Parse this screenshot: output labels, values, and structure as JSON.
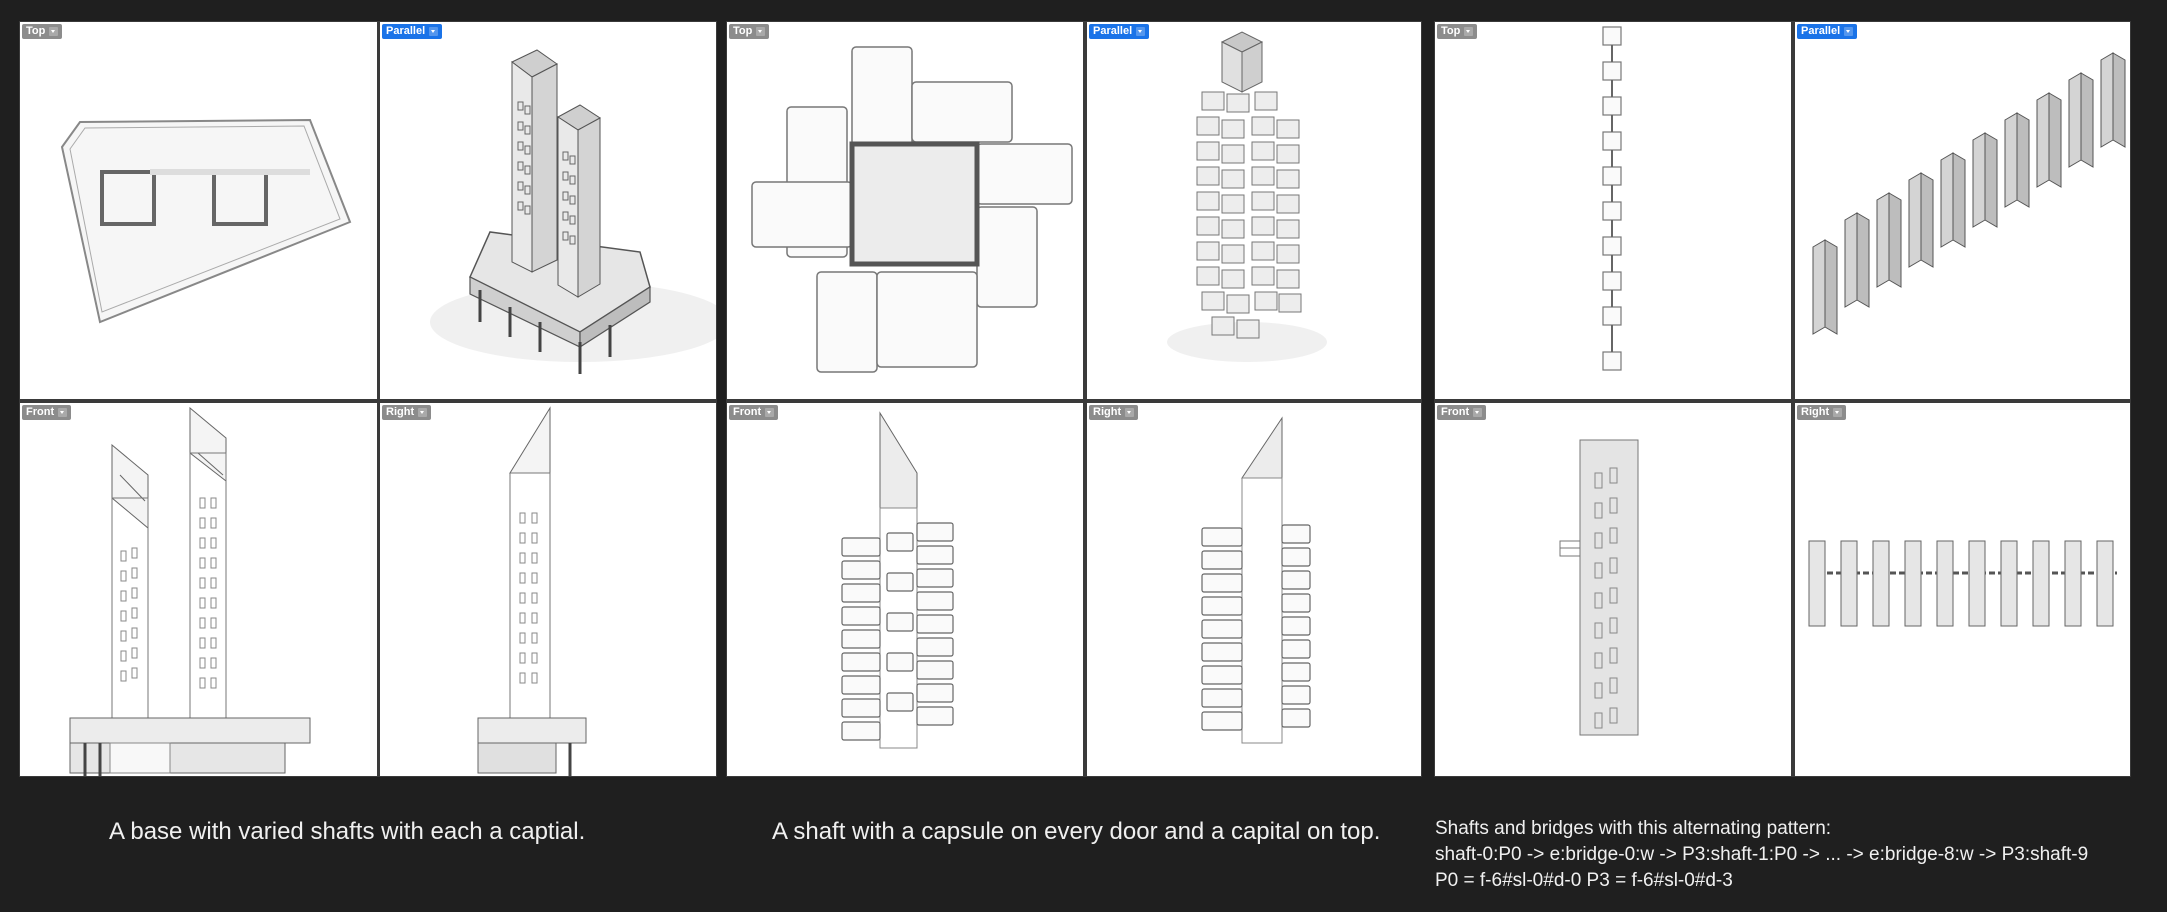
{
  "colors": {
    "background": "#1f1f1f",
    "viewport": "#ffffff",
    "active_label": "#1a73e8",
    "inactive_label": "#8c8c8c",
    "caption_text": "#f0f0f0"
  },
  "panels": [
    {
      "viewports": [
        {
          "label": "Top",
          "active": false
        },
        {
          "label": "Parallel",
          "active": true
        },
        {
          "label": "Front",
          "active": false
        },
        {
          "label": "Right",
          "active": false
        }
      ],
      "caption": "A base with varied shafts with each a captial."
    },
    {
      "viewports": [
        {
          "label": "Top",
          "active": false
        },
        {
          "label": "Parallel",
          "active": true
        },
        {
          "label": "Front",
          "active": false
        },
        {
          "label": "Right",
          "active": false
        }
      ],
      "caption": "A shaft with a capsule on every door and a capital on top."
    },
    {
      "viewports": [
        {
          "label": "Top",
          "active": false
        },
        {
          "label": "Parallel",
          "active": true
        },
        {
          "label": "Front",
          "active": false
        },
        {
          "label": "Right",
          "active": false
        }
      ],
      "caption_lines": [
        "Shafts and bridges with this alternating pattern:",
        "shaft-0:P0 -> e:bridge-0:w -> P3:shaft-1:P0 -> ... -> e:bridge-8:w -> P3:shaft-9",
        "P0 = f-6#sl-0#d-0 P3 = f-6#sl-0#d-3"
      ]
    }
  ]
}
